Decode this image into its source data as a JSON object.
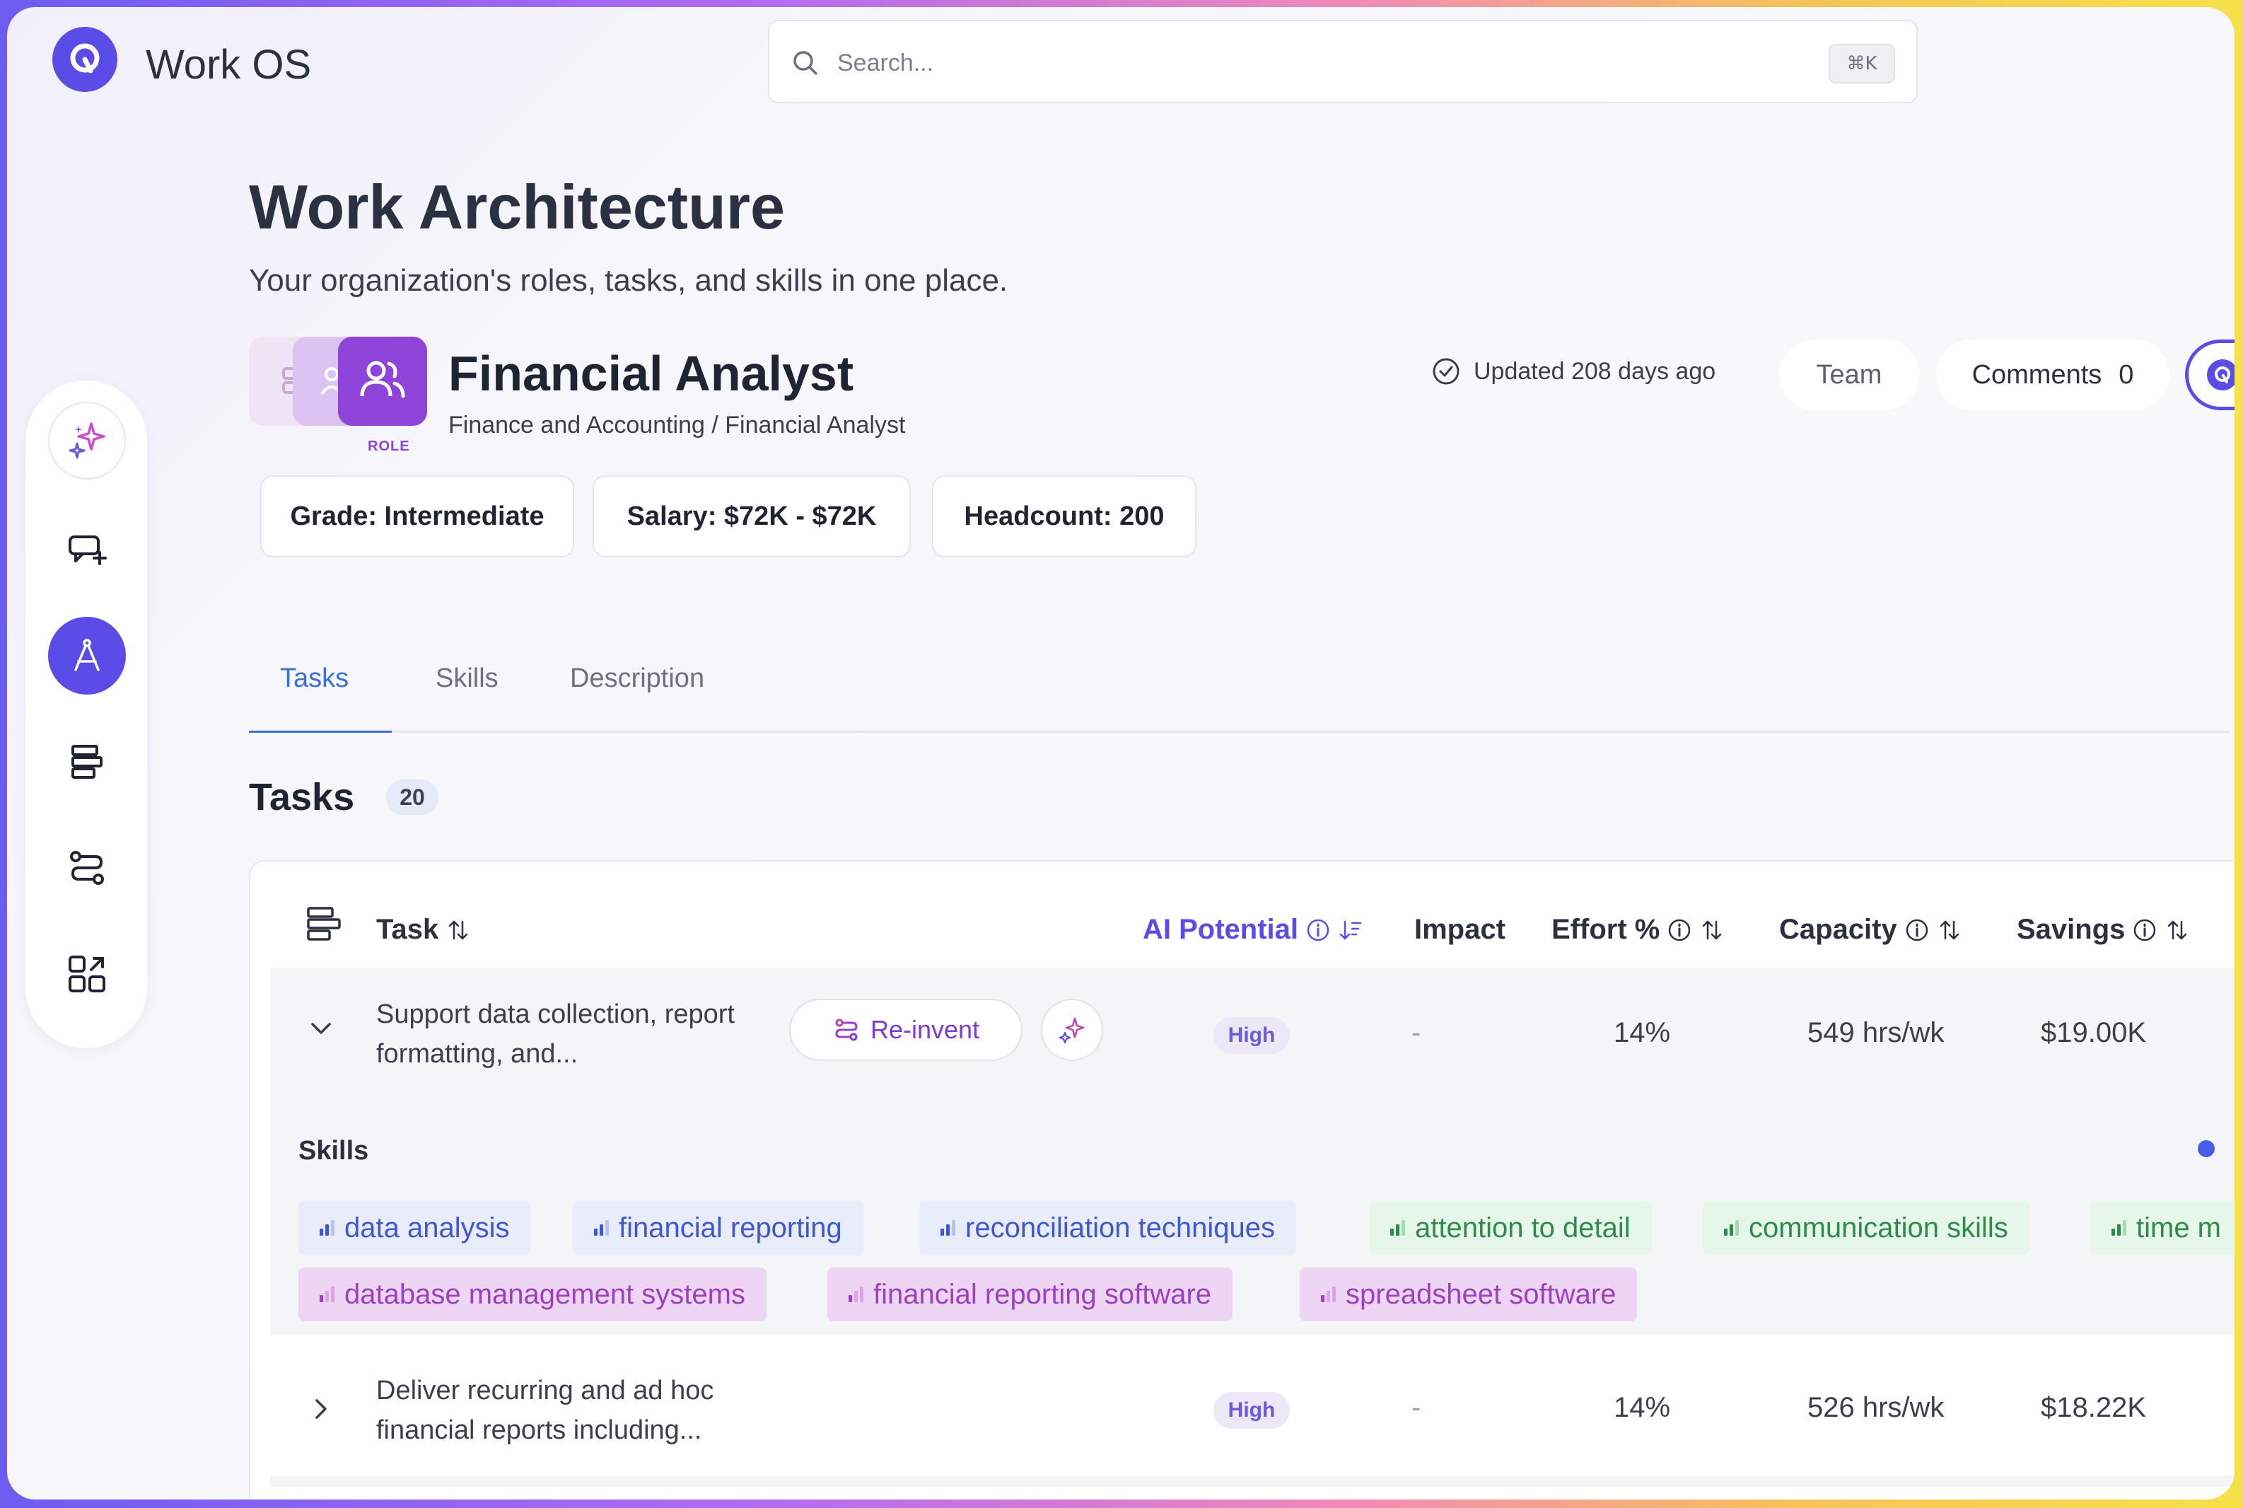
{
  "app": {
    "name": "Work OS"
  },
  "search": {
    "placeholder": "Search...",
    "shortcut": "⌘K"
  },
  "page": {
    "title": "Work Architecture",
    "subtitle": "Your organization's roles, tasks, and skills in one place."
  },
  "role": {
    "tag": "ROLE",
    "name": "Financial Analyst",
    "breadcrumb": "Finance and Accounting / Financial Analyst",
    "updated": "Updated 208 days ago",
    "team_label": "Team",
    "comments_label": "Comments",
    "comments_count": "0",
    "chips": {
      "grade": "Grade: Intermediate",
      "salary": "Salary: $72K - $72K",
      "headcount": "Headcount: 200"
    }
  },
  "tabs": {
    "tasks": "Tasks",
    "skills": "Skills",
    "description": "Description"
  },
  "tasks_section": {
    "title": "Tasks",
    "count": "20"
  },
  "table": {
    "headers": {
      "task": "Task",
      "ai_potential": "AI Potential",
      "impact": "Impact",
      "effort": "Effort %",
      "capacity": "Capacity",
      "savings": "Savings"
    },
    "rows": [
      {
        "task": "Support data collection, report formatting, and...",
        "reinvent_label": "Re-invent",
        "ai_potential": "High",
        "impact": "-",
        "effort": "14%",
        "capacity": "549 hrs/wk",
        "savings": "$19.00K"
      },
      {
        "task": "Deliver recurring and ad hoc financial reports including...",
        "ai_potential": "High",
        "impact": "-",
        "effort": "14%",
        "capacity": "526 hrs/wk",
        "savings": "$18.22K"
      }
    ],
    "skills_label": "Skills",
    "skills": [
      {
        "name": "data analysis",
        "kind": "blue"
      },
      {
        "name": "financial reporting",
        "kind": "blue"
      },
      {
        "name": "reconciliation techniques",
        "kind": "blue"
      },
      {
        "name": "attention to detail",
        "kind": "green"
      },
      {
        "name": "communication skills",
        "kind": "green"
      },
      {
        "name": "time m",
        "kind": "green"
      },
      {
        "name": "database management systems",
        "kind": "purple"
      },
      {
        "name": "financial reporting software",
        "kind": "purple"
      },
      {
        "name": "spreadsheet software",
        "kind": "purple"
      }
    ]
  },
  "colors": {
    "accent": "#5b4ce8",
    "role_purple": "#8e44d8",
    "tab_active": "#3b6fd4",
    "skill_blue": "#3f57cf",
    "skill_green": "#2f8a4e",
    "skill_purple": "#9c3fc0"
  },
  "icons": {
    "logo": "workos-logo-icon",
    "search": "search-icon",
    "rail": [
      "sparkles-icon",
      "chat-plus-icon",
      "compass-icon",
      "stack-icon",
      "flow-icon",
      "apps-grid-icon"
    ]
  }
}
